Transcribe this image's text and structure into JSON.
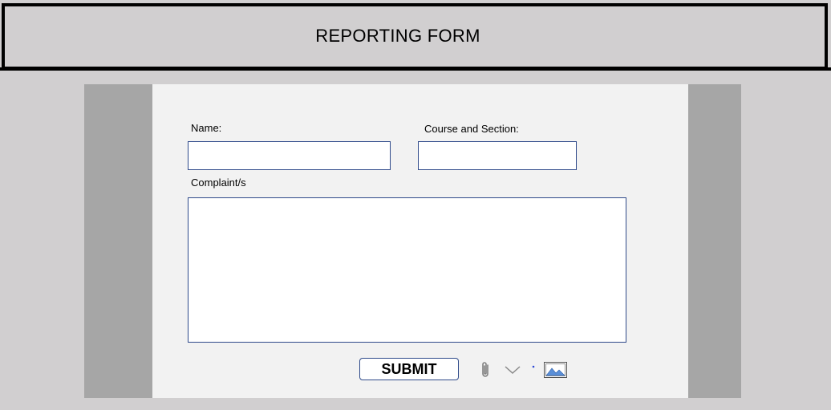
{
  "header": {
    "title": "REPORTING FORM"
  },
  "form": {
    "name_label": "Name:",
    "course_label": "Course and Section:",
    "complaint_label": "Complaint/s",
    "name_value": "",
    "course_value": "",
    "complaint_value": "",
    "submit_label": "SUBMIT"
  },
  "icons": {
    "attach": "paperclip-icon",
    "dropdown": "chevron-down-icon",
    "image": "image-icon",
    "accent": "#2f6fd6"
  },
  "colors": {
    "background": "#d1cfd0",
    "side_panel": "#a6a6a6",
    "form_area": "#f2f2f2",
    "field_border": "#2f4a8a"
  }
}
